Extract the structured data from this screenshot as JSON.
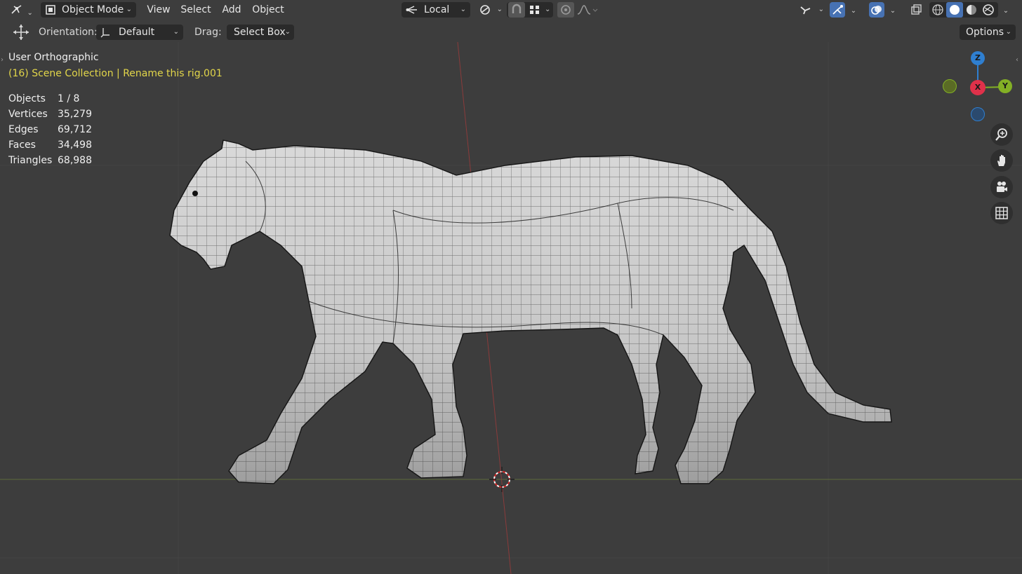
{
  "header": {
    "mode_label": "Object Mode",
    "menus": [
      "View",
      "Select",
      "Add",
      "Object"
    ],
    "pivot_label": "Local",
    "options_label": "Options"
  },
  "tool_settings": {
    "orientation_label": "Orientation:",
    "orientation_value": "Default",
    "drag_label": "Drag:",
    "drag_value": "Select Box"
  },
  "overlay": {
    "view_name": "User Orthographic",
    "collection_info": "(16) Scene Collection | Rename this rig.001",
    "stats": [
      {
        "label": "Objects",
        "value": "1 / 8"
      },
      {
        "label": "Vertices",
        "value": "35,279"
      },
      {
        "label": "Edges",
        "value": "69,712"
      },
      {
        "label": "Faces",
        "value": "34,498"
      },
      {
        "label": "Triangles",
        "value": "68,988"
      }
    ]
  },
  "gizmo": {
    "z_label": "Z",
    "x_label": "X",
    "y_label": "Y",
    "z_color": "#2f7fd0",
    "x_color": "#e0314a",
    "y_color": "#83b025"
  },
  "colors": {
    "viewport_bg": "#3d3d3d",
    "button_bg": "#2a2a2a",
    "active_blue": "#4772b3",
    "collection_text": "#e2d64a"
  },
  "icons": [
    "editor-type-icon",
    "object-mode-icon",
    "transform-orientation-icon",
    "snap-icon",
    "proportional-icon",
    "visibility-icon",
    "gizmo-icon",
    "overlay-icon",
    "xray-icon",
    "shading-wire-icon",
    "shading-solid-icon",
    "shading-material-icon",
    "shading-rendered-icon",
    "zoom-icon",
    "pan-hand-icon",
    "camera-icon",
    "grid-icon",
    "move-tool-icon",
    "3d-cursor-icon"
  ]
}
